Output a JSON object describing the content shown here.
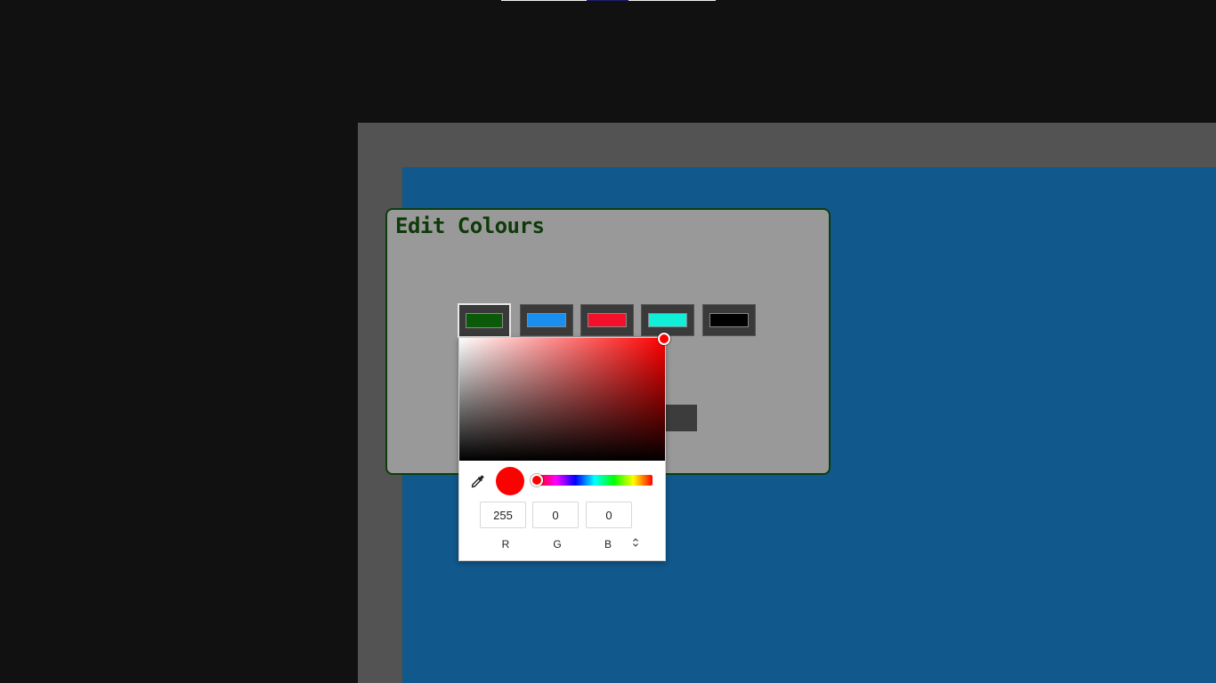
{
  "top_bar": {
    "colors": [
      "#f2f2f2",
      "#1d1d6b",
      "#f2f2f2"
    ]
  },
  "dialog": {
    "title": "Edit Colours",
    "swatches": [
      {
        "color": "#0a5a0a",
        "active": true
      },
      {
        "color": "#1a8ff0"
      },
      {
        "color": "#f2102a"
      },
      {
        "color": "#10f0d8"
      },
      {
        "color": "#000000"
      }
    ]
  },
  "picker": {
    "hue_color": "#ff0000",
    "current_color": "#ff0000",
    "r": "255",
    "g": "0",
    "b": "0",
    "labels": {
      "r": "R",
      "g": "G",
      "b": "B"
    },
    "eyedropper_icon": "eyedropper-icon",
    "mode_toggle_icon": "updown-chevron-icon"
  }
}
